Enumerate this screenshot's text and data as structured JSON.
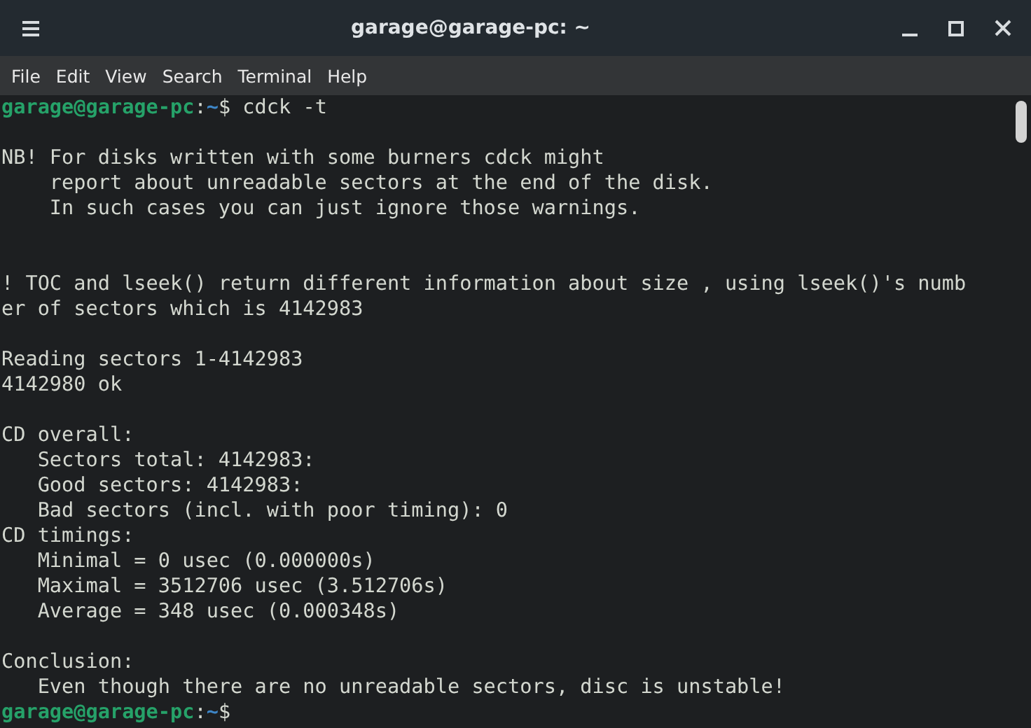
{
  "window": {
    "title": "garage@garage-pc: ~"
  },
  "menu": [
    {
      "label": "File"
    },
    {
      "label": "Edit"
    },
    {
      "label": "View"
    },
    {
      "label": "Search"
    },
    {
      "label": "Terminal"
    },
    {
      "label": "Help"
    }
  ],
  "terminal": {
    "lines": [
      {
        "kind": "prompt",
        "user": "garage@garage-pc",
        "separator": ":",
        "path": "~",
        "symbol": "$",
        "command": "cdck -t"
      },
      {
        "kind": "blank"
      },
      {
        "kind": "output",
        "text": "NB! For disks written with some burners cdck might"
      },
      {
        "kind": "output",
        "text": "    report about unreadable sectors at the end of the disk."
      },
      {
        "kind": "output",
        "text": "    In such cases you can just ignore those warnings."
      },
      {
        "kind": "blank"
      },
      {
        "kind": "blank"
      },
      {
        "kind": "output",
        "text": "! TOC and lseek() return different information about size , using lseek()'s numb"
      },
      {
        "kind": "output",
        "text": "er of sectors which is 4142983"
      },
      {
        "kind": "blank"
      },
      {
        "kind": "output",
        "text": "Reading sectors 1-4142983"
      },
      {
        "kind": "output",
        "text": "4142980 ok"
      },
      {
        "kind": "blank"
      },
      {
        "kind": "output",
        "text": "CD overall:"
      },
      {
        "kind": "output",
        "text": "   Sectors total: 4142983:"
      },
      {
        "kind": "output",
        "text": "   Good sectors: 4142983:"
      },
      {
        "kind": "output",
        "text": "   Bad sectors (incl. with poor timing): 0"
      },
      {
        "kind": "output",
        "text": "CD timings:"
      },
      {
        "kind": "output",
        "text": "   Minimal = 0 usec (0.000000s)"
      },
      {
        "kind": "output",
        "text": "   Maximal = 3512706 usec (3.512706s)"
      },
      {
        "kind": "output",
        "text": "   Average = 348 usec (0.000348s)"
      },
      {
        "kind": "blank"
      },
      {
        "kind": "output",
        "text": "Conclusion:"
      },
      {
        "kind": "output",
        "text": "   Even though there are no unreadable sectors, disc is unstable!"
      },
      {
        "kind": "prompt",
        "user": "garage@garage-pc",
        "separator": ":",
        "path": "~",
        "symbol": "$"
      }
    ]
  }
}
